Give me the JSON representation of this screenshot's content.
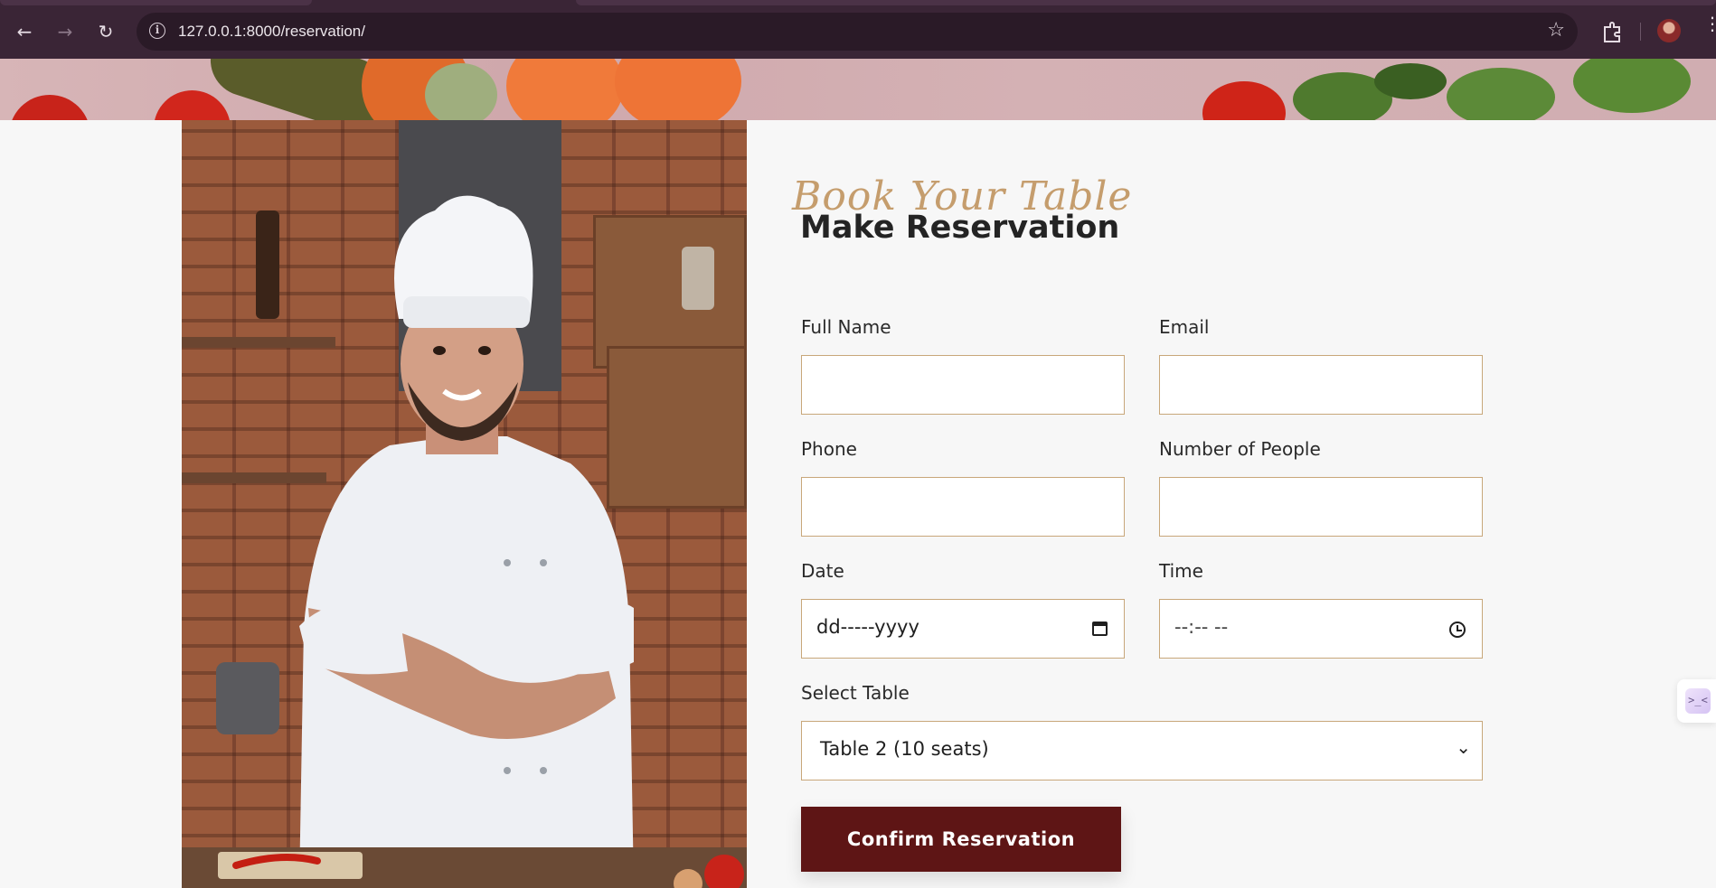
{
  "browser": {
    "url": "127.0.0.1:8000/reservation/",
    "icons": [
      "back-arrow-icon",
      "forward-arrow-icon",
      "reload-icon",
      "site-info-icon",
      "bookmark-star-icon",
      "extensions-icon",
      "profile-avatar",
      "menu-dots-icon"
    ]
  },
  "reservation": {
    "script_title": "Book Your Table",
    "title": "Make Reservation",
    "fields": {
      "full_name": {
        "label": "Full Name",
        "value": ""
      },
      "email": {
        "label": "Email",
        "value": ""
      },
      "phone": {
        "label": "Phone",
        "value": ""
      },
      "people": {
        "label": "Number of People",
        "value": ""
      },
      "date": {
        "label": "Date",
        "placeholder": "dd-----yyyy"
      },
      "time": {
        "label": "Time",
        "placeholder": "--:-- --"
      },
      "table": {
        "label": "Select Table",
        "selected": "Table 2 (10 seats)"
      }
    },
    "submit_label": "Confirm Reservation"
  },
  "side_widget": {
    "glyph": ">_<"
  },
  "colors": {
    "chrome_bg": "#3a2536",
    "accent_gold": "#c59d6d",
    "field_border": "#c8a77a",
    "button_bg": "#5e1515"
  }
}
